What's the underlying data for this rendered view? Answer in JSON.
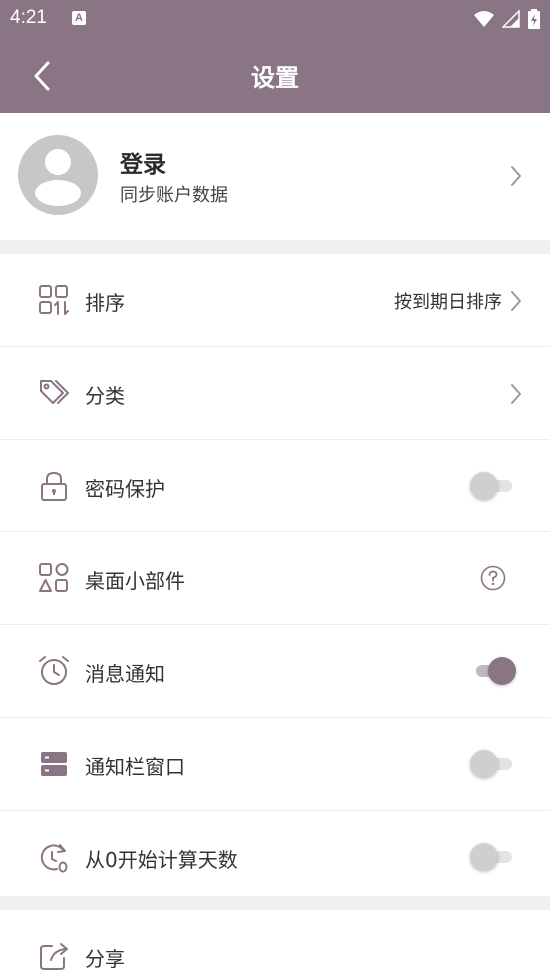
{
  "status_bar": {
    "time": "4:21",
    "notification_badge": "A"
  },
  "app_bar": {
    "title": "设置",
    "back_icon": "chevron-left-icon"
  },
  "account": {
    "title": "登录",
    "subtitle": "同步账户数据"
  },
  "settings": {
    "sort": {
      "label": "排序",
      "value": "按到期日排序"
    },
    "category": {
      "label": "分类"
    },
    "password": {
      "label": "密码保护",
      "enabled": false
    },
    "widget": {
      "label": "桌面小部件"
    },
    "notification": {
      "label": "消息通知",
      "enabled": true
    },
    "notification_bar": {
      "label": "通知栏窗口",
      "enabled": false
    },
    "count_from_zero": {
      "label": "从0开始计算天数",
      "enabled": false
    },
    "share": {
      "label": "分享"
    }
  },
  "colors": {
    "primary": "#8a7585",
    "toggle_off": "#cfcfcf",
    "divider": "#efefef"
  }
}
